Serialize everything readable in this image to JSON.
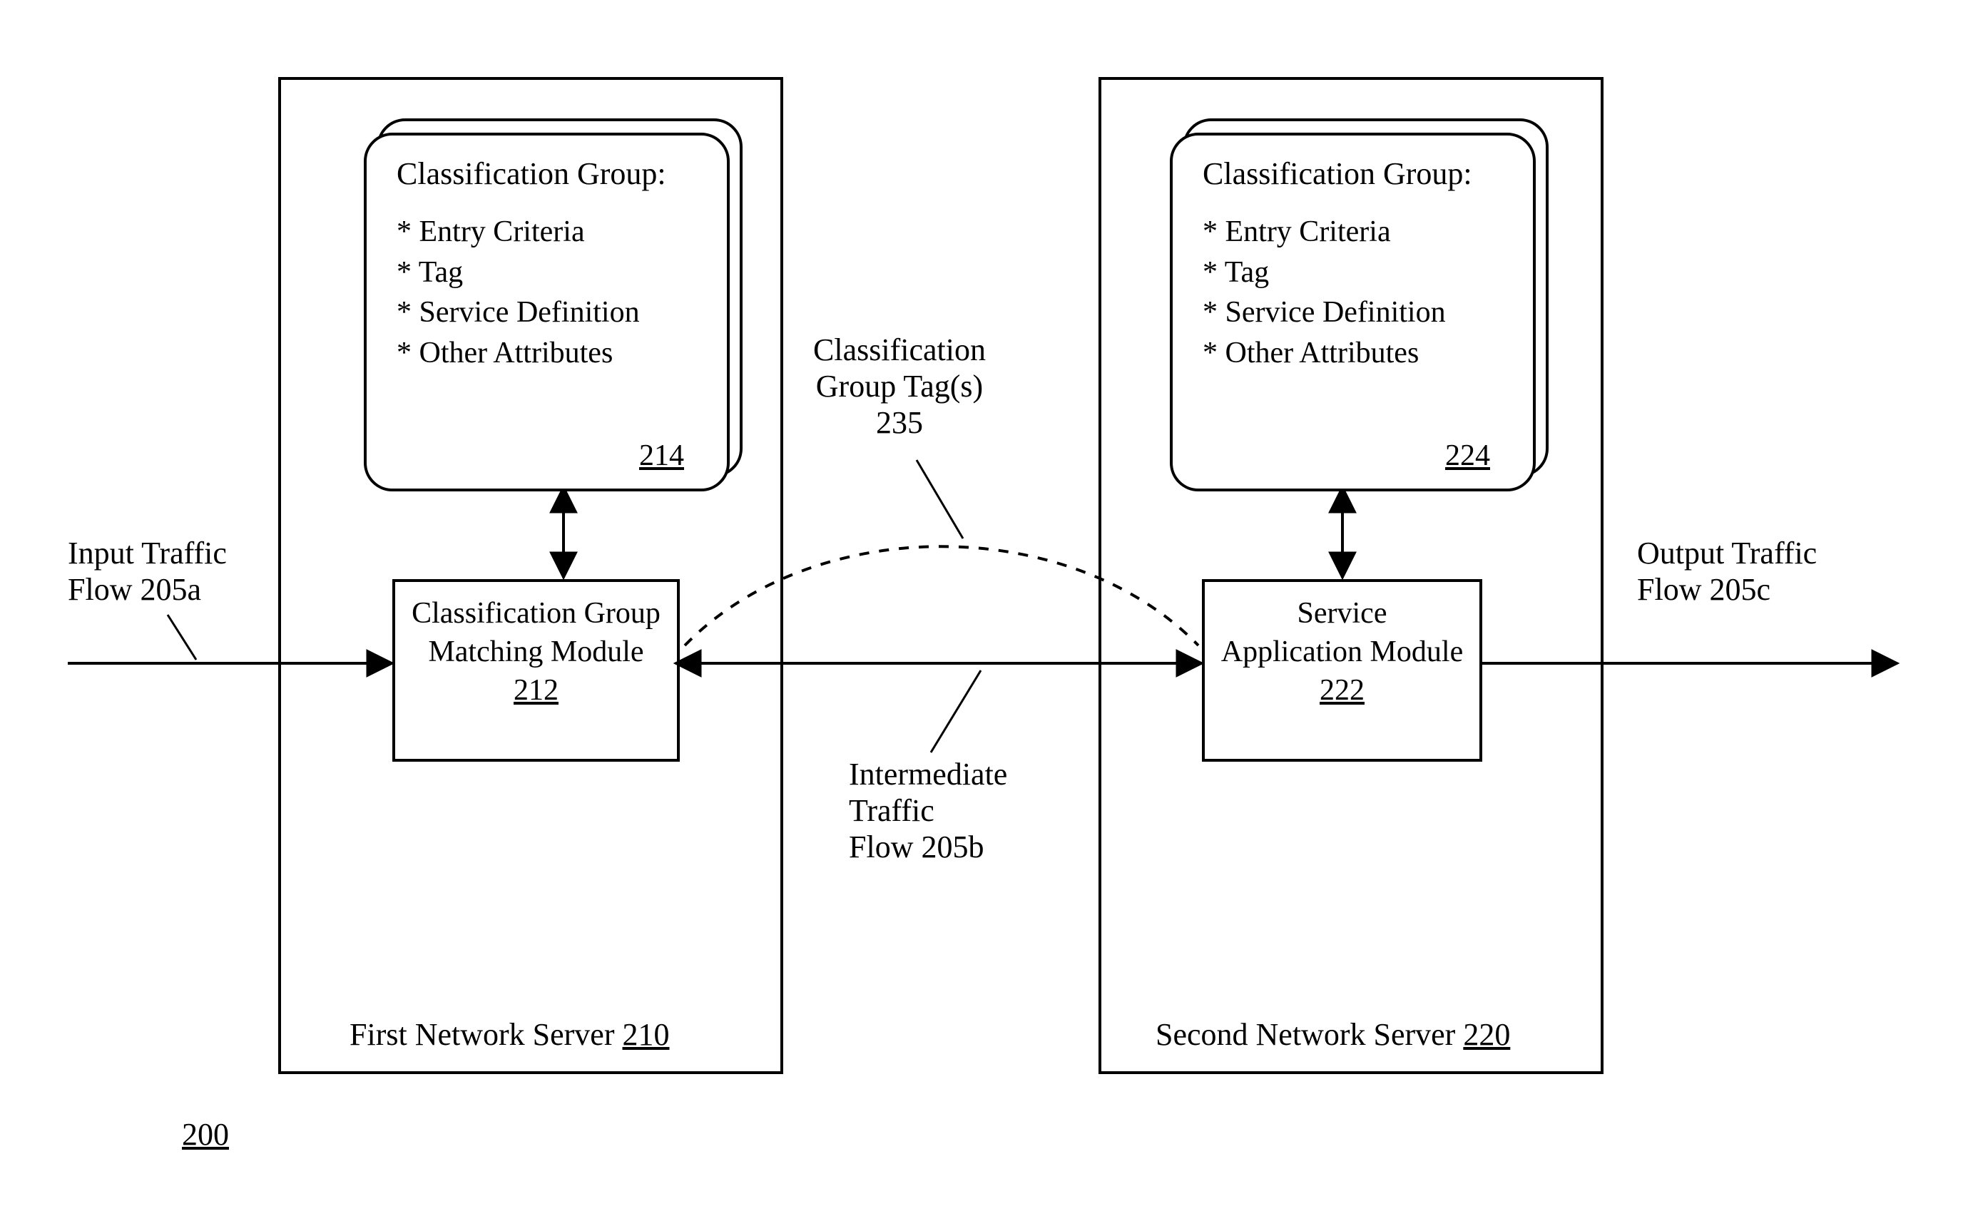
{
  "fig_ref": "200",
  "server1": {
    "label_prefix": "First Network Server ",
    "ref": "210",
    "card": {
      "title": "Classification Group:",
      "items": [
        "* Entry Criteria",
        "* Tag",
        "* Service Definition",
        "* Other Attributes"
      ],
      "ref": "214"
    },
    "module": {
      "line1": "Classification Group",
      "line2": "Matching Module",
      "ref": "212"
    }
  },
  "server2": {
    "label_prefix": "Second Network Server ",
    "ref": "220",
    "card": {
      "title": "Classification Group:",
      "items": [
        "* Entry Criteria",
        "* Tag",
        "* Service Definition",
        "* Other Attributes"
      ],
      "ref": "224"
    },
    "module": {
      "line1": "Service",
      "line2": "Application Module",
      "ref": "222"
    }
  },
  "labels": {
    "input_flow_l1": "Input Traffic",
    "input_flow_l2": "Flow 205a",
    "output_flow_l1": "Output Traffic",
    "output_flow_l2": "Flow 205c",
    "intermediate_l1": "Intermediate",
    "intermediate_l2": "Traffic",
    "intermediate_l3": "Flow 205b",
    "tags_l1": "Classification",
    "tags_l2": "Group Tag(s)",
    "tags_l3": "235"
  }
}
